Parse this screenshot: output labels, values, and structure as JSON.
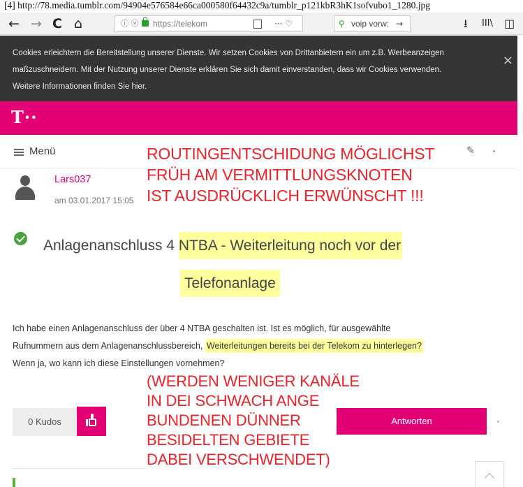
{
  "caption": "[4] http://78.media.tumblr.com/94904e576584e66ca000580f64432c9a/tumblr_p121kbR3hK1sofvubo1_1280.jpg",
  "browser": {
    "back": "←",
    "forward": "→",
    "reload": "C",
    "home": "⌂",
    "url": "https://telekom",
    "url_info": "ⓘ ⓥ",
    "page_actions": "··· ♡ ☆",
    "search_value": "voip vorw:",
    "search_go": "→",
    "download": "⭳",
    "library": "III\\",
    "sidebar": "◫"
  },
  "cookie_banner": {
    "line1": "Cookies erleichtern die Bereitstellung unserer Dienste. Wir setzen Cookies von Drittanbietern ein um z.B. Werbeanzeigen",
    "line2": "maßzuschneidern. Mit der Nutzung unserer Dienste erklären Sie sich damit einverstanden, dass wir Cookies verwenden.",
    "line3": "Weitere Informationen finden Sie hier.",
    "close": "×"
  },
  "brand": {
    "logo": "T··"
  },
  "menu": {
    "label": "Menü"
  },
  "post": {
    "author": "Lars037",
    "date": "am 03.01.2017 15:05",
    "title_part1": "Anlagenanschluss 4 ",
    "title_part1_hl": "NTBA - Weiterleitung noch vor der",
    "title_line2": "Telefonanlage",
    "body_line1": "Ich habe einen Anlagenanschluss der über 4 NTBA geschalten ist. Ist es möglich, für ausgewählte",
    "body_line2_a": "Rufnummern aus dem Anlagenanschlussbereich, ",
    "body_line2_hl": "Weiterleitungen bereits bei der Telekom zu hinterlegen?",
    "body_line3": "Wenn ja, wo kann ich diese Einstellungen vornehmen?"
  },
  "actions": {
    "kudos": "0 Kudos",
    "reply": "Antworten"
  },
  "annotations": {
    "top": [
      "ROUTINGENTSCHIDUNG MÖGLICHST",
      "FRÜH AM VERMITTLUNGSKNOTEN",
      "IST AUSDRÜCKLICH ERWÜNSCHT !!!"
    ],
    "bottom": [
      "(WERDEN WENIGER KANÄLE",
      "IN DEI SCHWACH ANGE",
      "BUNDENEN DÜNNER",
      "BESIDELTEN GEBIETE",
      "DABEI VERSCHWENDET)"
    ],
    "color": "#e8232b"
  },
  "colors": {
    "brand": "#e20074",
    "highlight": "#ffff9e",
    "solved": "#4aa13f",
    "cookie_bg": "#353535"
  }
}
